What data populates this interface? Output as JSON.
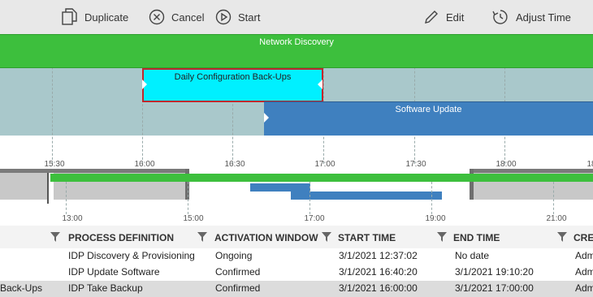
{
  "toolbar": {
    "duplicate_label": "Duplicate",
    "cancel_label": "Cancel",
    "start_label": "Start",
    "edit_label": "Edit",
    "adjust_time_label": "Adjust Time"
  },
  "gantt": {
    "bars": {
      "network_discovery": "Network Discovery",
      "daily_backup": "Daily Configuration Back-Ups",
      "software_update": "Software Update"
    },
    "time_ticks": [
      "15:30",
      "16:00",
      "16:30",
      "17:00",
      "17:30",
      "18:00",
      "18"
    ]
  },
  "overview": {
    "ticks": [
      "13:00",
      "15:00",
      "17:00",
      "19:00",
      "21:00"
    ]
  },
  "table": {
    "headers": [
      "PROCESS DEFINITION",
      "ACTIVATION WINDOW",
      "START TIME",
      "END TIME",
      "CREA"
    ],
    "rows": [
      {
        "name": "",
        "process": "IDP Discovery & Provisioning",
        "window": "Ongoing",
        "start": "3/1/2021 12:37:02",
        "end": "No date",
        "created": "Adm"
      },
      {
        "name": "",
        "process": "IDP Update Software",
        "window": "Confirmed",
        "start": "3/1/2021 16:40:20",
        "end": "3/1/2021 19:10:20",
        "created": "Adm"
      },
      {
        "name": "Back-Ups",
        "process": "IDP Take Backup",
        "window": "Confirmed",
        "start": "3/1/2021 16:00:00",
        "end": "3/1/2021 17:00:00",
        "created": "Adm"
      }
    ]
  }
}
